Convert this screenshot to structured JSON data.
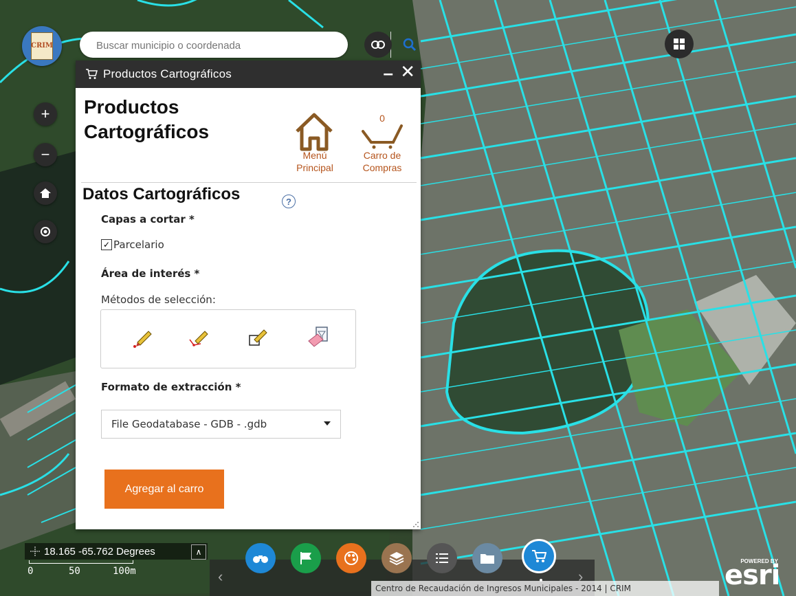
{
  "app": {
    "logo_text": "CRIM",
    "search_placeholder": "Buscar municipio o coordenada"
  },
  "panel": {
    "header_title": "Productos Cartográficos",
    "minimize_label": "–",
    "close_label": "✕",
    "big_title_line1": "Productos",
    "big_title_line2": "Cartográficos",
    "home_label_1": "Menú",
    "home_label_2": "Principal",
    "cart_label_1": "Carro de",
    "cart_label_2": "Compras",
    "cart_count": "0",
    "section_title": "Datos Cartográficos",
    "help_label": "?",
    "layers_label": "Capas a cortar *",
    "layer_option": "Parcelario",
    "layer_checked": true,
    "area_label": "Área de interés *",
    "methods_label": "Métodos de selección:",
    "format_label": "Formato de extracción *",
    "format_value": "File Geodatabase - GDB - .gdb",
    "add_button": "Agregar al carro"
  },
  "map_controls": {
    "zoom_in": "+",
    "zoom_out": "−"
  },
  "coordinates": {
    "text": "18.165 -65.762 Degrees"
  },
  "scale": {
    "label_0": "0",
    "label_50": "50",
    "label_100": "100m"
  },
  "attribution": "Centro de Recaudación de Ingresos Municipales - 2014 | CRIM",
  "esri": {
    "powered": "POWERED BY",
    "logo": "esri"
  },
  "colors": {
    "parcel_lines": "#29e0e6",
    "accent_orange": "#e8711d",
    "link_brown": "#b5541c",
    "toolbar_blue": "#1e88d6",
    "toolbar_green": "#1a9e4a",
    "toolbar_orange": "#e8711d",
    "toolbar_brown": "#9a7450"
  }
}
